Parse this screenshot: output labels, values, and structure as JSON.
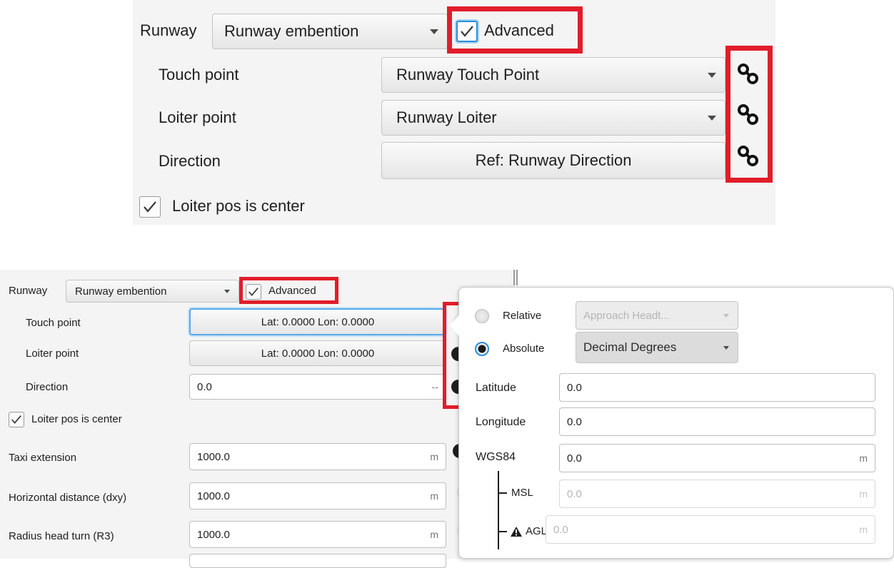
{
  "top": {
    "runway_label": "Runway",
    "runway_value": "Runway embention",
    "advanced_label": "Advanced",
    "touch_label": "Touch point",
    "touch_value": "Runway Touch Point",
    "loiter_label": "Loiter point",
    "loiter_value": "Runway Loiter",
    "direction_label": "Direction",
    "direction_value": "Ref: Runway Direction",
    "loiter_center_label": "Loiter pos is center"
  },
  "bottom": {
    "runway_label": "Runway",
    "runway_value": "Runway embention",
    "advanced_label": "Advanced",
    "touch_label": "Touch point",
    "touch_value": "Lat: 0.0000  Lon: 0.0000",
    "loiter_label": "Loiter point",
    "loiter_value": "Lat: 0.0000  Lon: 0.0000",
    "direction_label": "Direction",
    "direction_value": "0.0",
    "direction_unit": "--",
    "loiter_center_label": "Loiter pos is center",
    "taxi_label": "Taxi extension",
    "taxi_value": "1000.0",
    "taxi_unit": "m",
    "dxy_label": "Horizontal distance (dxy)",
    "dxy_value": "1000.0",
    "dxy_unit": "m",
    "r3_label": "Radius head turn (R3)",
    "r3_value": "1000.0",
    "r3_unit": "m"
  },
  "popup": {
    "relative_label": "Relative",
    "relative_combo": "Approach Headt...",
    "absolute_label": "Absolute",
    "absolute_combo": "Decimal Degrees",
    "latitude_label": "Latitude",
    "latitude_value": "0.0",
    "longitude_label": "Longitude",
    "longitude_value": "0.0",
    "wgs84_label": "WGS84",
    "wgs84_value": "0.0",
    "wgs84_unit": "m",
    "msl_label": "MSL",
    "msl_value": "0.0",
    "msl_unit": "m",
    "agl_label": "AGL",
    "agl_value": "0.0",
    "agl_unit": "m"
  },
  "colors": {
    "highlight": "#e11d2a",
    "focus": "#2b8fd8"
  }
}
